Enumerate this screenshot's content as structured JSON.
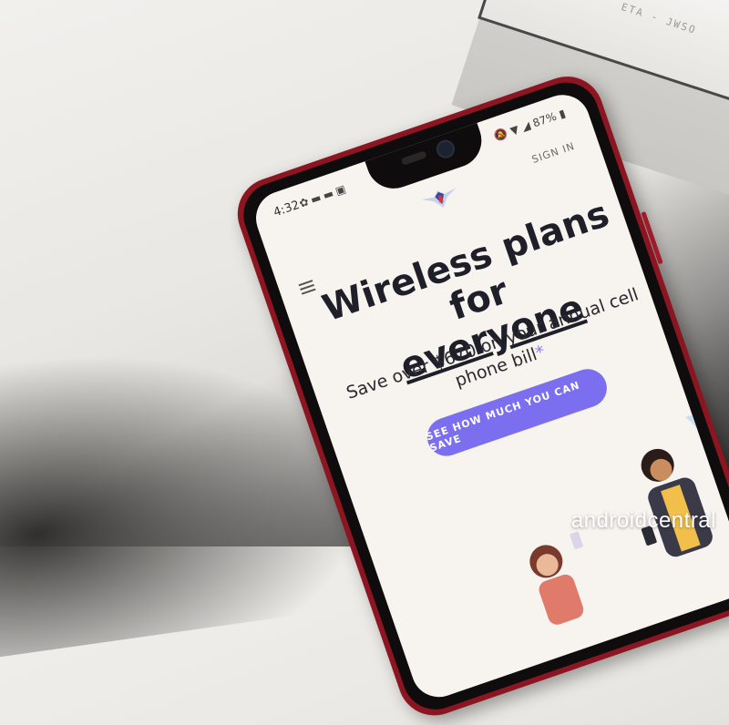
{
  "window": {
    "label": "ETA - JWSO"
  },
  "phone": {
    "status_bar": {
      "time": "4:32",
      "battery": "87%"
    },
    "header": {
      "sign_in": "SIGN IN"
    },
    "headline": {
      "line1": "Wireless plans for",
      "line2": "everyone"
    },
    "subtext": "Save over $670 on your annual cell phone bill",
    "asterisk": "*",
    "cta_label": "SEE HOW MUCH YOU CAN SAVE"
  },
  "watermark": "androidcentral",
  "colors": {
    "phone_body": "#8b1622",
    "cta": "#7b6ff0",
    "screen_bg": "#f7f3ef"
  }
}
